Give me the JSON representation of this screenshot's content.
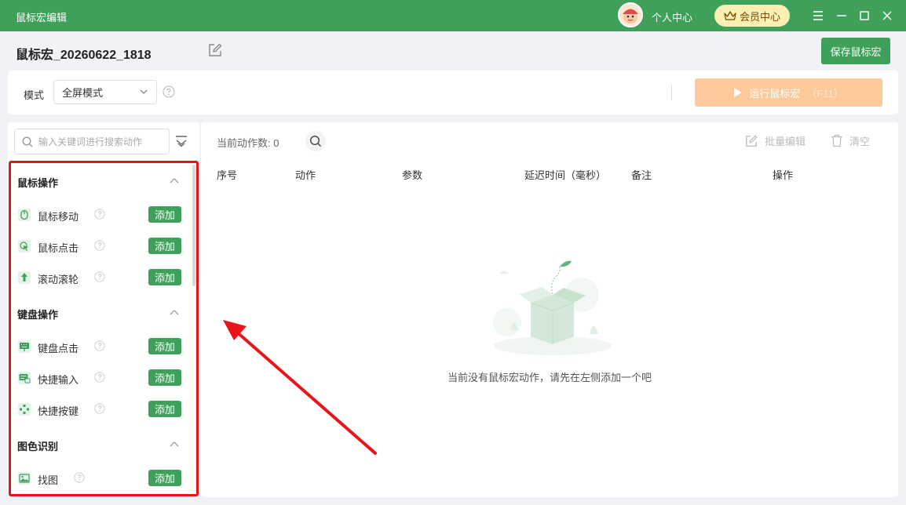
{
  "titlebar": {
    "app_title": "鼠标宏编辑",
    "user_center": "个人中心",
    "vip_label": "会员中心"
  },
  "header": {
    "macro_name": "鼠标宏_20260622_1818",
    "save_label": "保存鼠标宏"
  },
  "mode": {
    "label": "模式",
    "selected": "全屏模式",
    "run_label": "运行鼠标宏",
    "run_hotkey": "（F11）"
  },
  "left": {
    "search_placeholder": "输入关键词进行搜索动作",
    "add_label": "添加",
    "categories": [
      {
        "title": "鼠标操作",
        "items": [
          "鼠标移动",
          "鼠标点击",
          "滚动滚轮"
        ]
      },
      {
        "title": "键盘操作",
        "items": [
          "键盘点击",
          "快捷输入",
          "快捷按键"
        ]
      },
      {
        "title": "图色识别",
        "items": [
          "找图"
        ]
      }
    ]
  },
  "right": {
    "count_label": "当前动作数:",
    "count_value": "0",
    "batch_edit": "批量编辑",
    "clear": "清空",
    "columns": [
      "序号",
      "动作",
      "参数",
      "延迟时间（毫秒）",
      "备注",
      "操作"
    ],
    "empty_text": "当前没有鼠标宏动作，请先在左侧添加一个吧"
  },
  "colors": {
    "brand_green": "#3fa05a",
    "run_orange": "#fbc99a",
    "highlight_red": "#e8141a"
  }
}
